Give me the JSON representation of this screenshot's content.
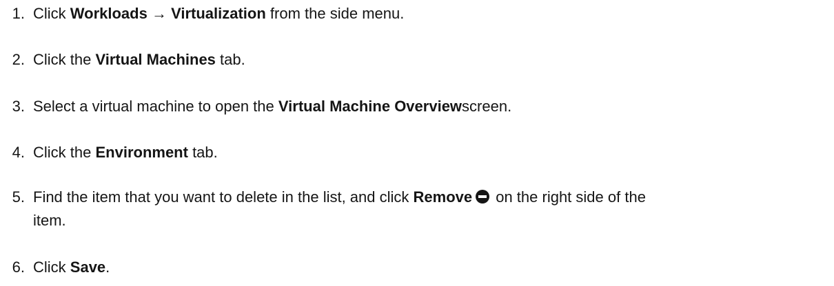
{
  "steps": [
    {
      "num": "1.",
      "pre": "Click ",
      "bold1": "Workloads → Virtualization",
      "post": " from the side menu."
    },
    {
      "num": "2.",
      "pre": "Click the ",
      "bold1": "Virtual Machines",
      "post": " tab."
    },
    {
      "num": "3.",
      "pre": "Select a virtual machine to open the ",
      "bold1": "Virtual Machine Overview",
      "post": "screen."
    },
    {
      "num": "4.",
      "pre": "Click the ",
      "bold1": "Environment",
      "post": " tab."
    },
    {
      "num": "5.",
      "pre": "Find the item that you want to delete in the list, and click ",
      "bold1": "Remove",
      "post": " on the right side of the",
      "line2": "item.",
      "icon": "remove-circle-icon"
    },
    {
      "num": "6.",
      "pre": "Click ",
      "bold1": "Save",
      "post": "."
    }
  ]
}
